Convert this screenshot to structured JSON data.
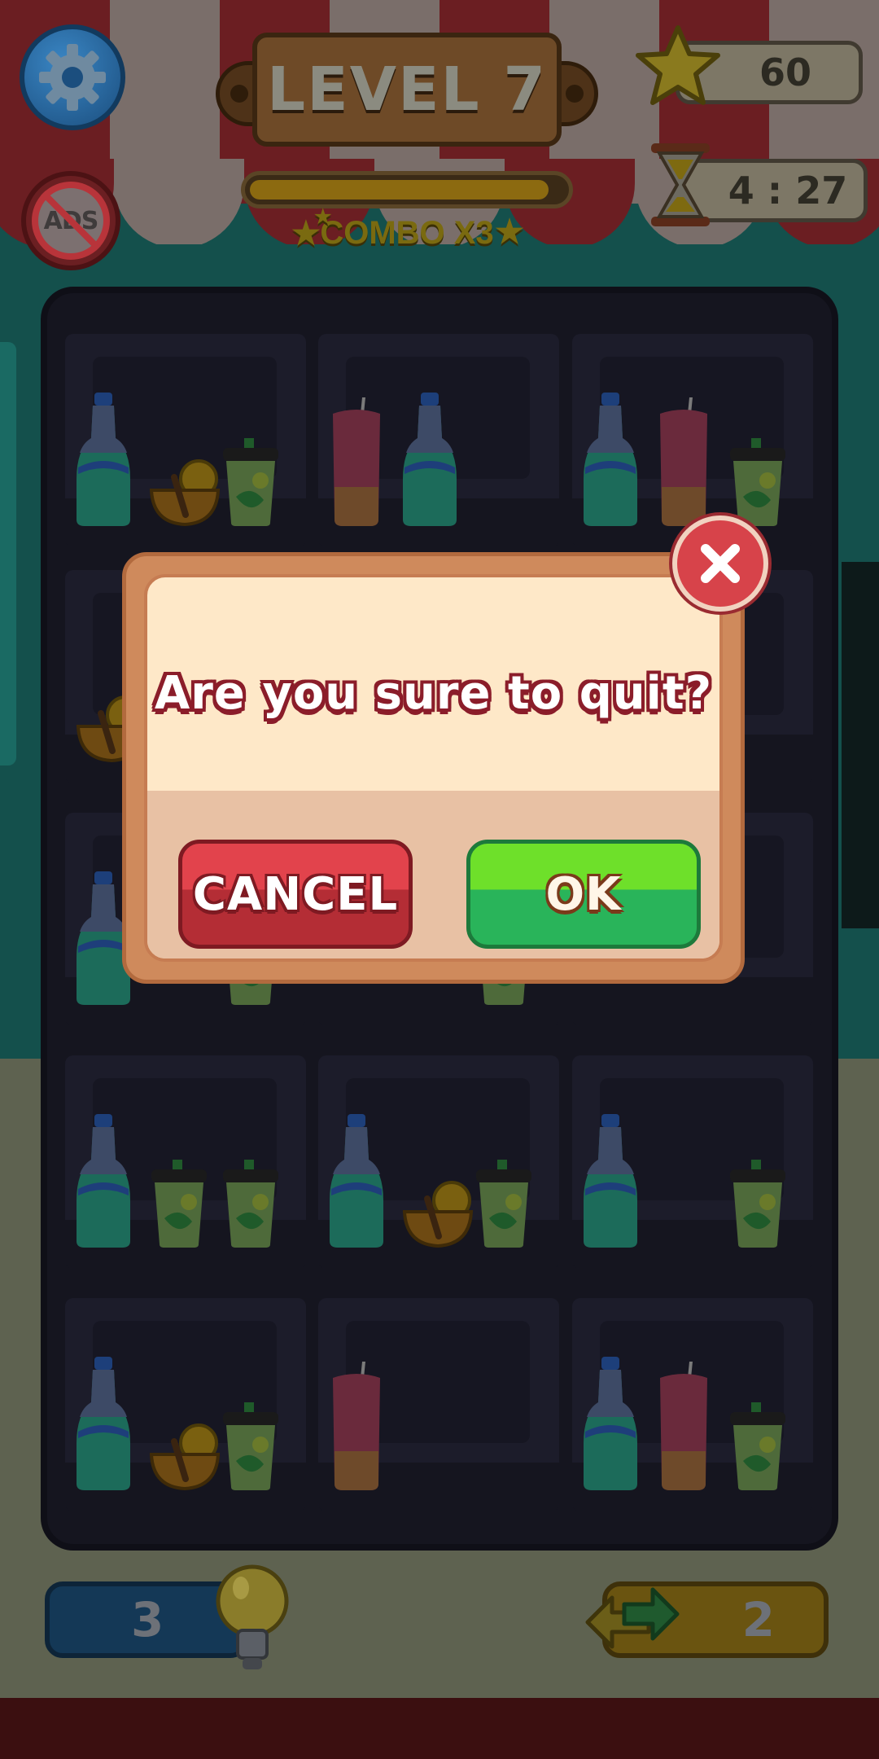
{
  "hud": {
    "level_label": "LEVEL 7",
    "combo_label": "COMBO X3",
    "level_progress": 0.95,
    "stars": "60",
    "timer": "4 : 27",
    "settings_icon": "gear-icon",
    "no_ads_label": "ADS"
  },
  "dialog": {
    "message": "Are you sure to quit?",
    "cancel_label": "CANCEL",
    "ok_label": "OK",
    "close_icon": "close-icon"
  },
  "boosters": {
    "hint_count": "3",
    "shuffle_count": "2"
  },
  "shelf": {
    "rows": 5,
    "cols": 3,
    "cells": [
      [
        "soda-bottle",
        "honey-bowl",
        "mojito-cup"
      ],
      [
        "pink-lemonade",
        "soda-bottle"
      ],
      [
        "soda-bottle",
        "pink-lemonade",
        "mojito-cup"
      ],
      [
        "honey-bowl"
      ],
      [],
      [],
      [
        "soda-bottle",
        "",
        "mojito-cup"
      ],
      [
        "",
        "",
        "mojito-cup"
      ],
      [],
      [
        "soda-bottle",
        "mojito-cup",
        "mojito-cup"
      ],
      [
        "soda-bottle",
        "honey-bowl",
        "mojito-cup"
      ],
      [
        "soda-bottle",
        "",
        "mojito-cup"
      ],
      [
        "soda-bottle",
        "honey-bowl",
        "mojito-cup"
      ],
      [
        "pink-lemonade"
      ],
      [
        "soda-bottle",
        "pink-lemonade",
        "mojito-cup"
      ]
    ]
  },
  "colors": {
    "cancel": "#e2434c",
    "ok": "#6ee02a",
    "dialog_bg": "#fee8c8",
    "message_outline": "#8b1d2a"
  }
}
